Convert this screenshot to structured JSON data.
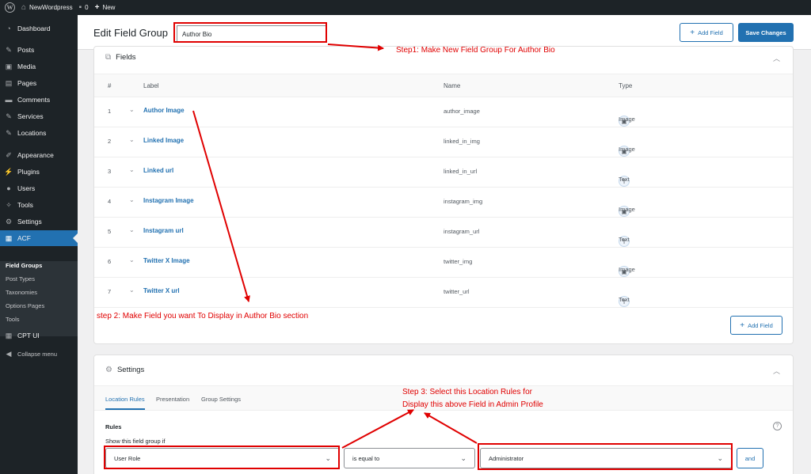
{
  "adminbar": {
    "site_name": "NewWordpress",
    "comments_count": "0",
    "new_label": "New"
  },
  "sidebar": {
    "items": [
      {
        "label": "Dashboard",
        "icon": "dashboard-icon"
      },
      {
        "label": "Posts",
        "icon": "pin-icon"
      },
      {
        "label": "Media",
        "icon": "media-icon"
      },
      {
        "label": "Pages",
        "icon": "pages-icon"
      },
      {
        "label": "Comments",
        "icon": "comment-icon"
      },
      {
        "label": "Services",
        "icon": "pin-icon"
      },
      {
        "label": "Locations",
        "icon": "pin-icon"
      },
      {
        "label": "Appearance",
        "icon": "brush-icon"
      },
      {
        "label": "Plugins",
        "icon": "plug-icon"
      },
      {
        "label": "Users",
        "icon": "users-icon"
      },
      {
        "label": "Tools",
        "icon": "wrench-icon"
      },
      {
        "label": "Settings",
        "icon": "settings-icon"
      },
      {
        "label": "ACF",
        "icon": "acf-icon"
      },
      {
        "label": "CPT UI",
        "icon": "cpt-icon"
      },
      {
        "label": "Collapse menu",
        "icon": "collapse-icon"
      }
    ],
    "submenu": [
      "Field Groups",
      "Post Types",
      "Taxonomies",
      "Options Pages",
      "Tools"
    ]
  },
  "header": {
    "title": "Edit Field Group",
    "group_title_value": "Author Bio",
    "add_field_label": "Add Field",
    "save_label": "Save Changes"
  },
  "fields_panel": {
    "title": "Fields",
    "columns": [
      "#",
      "Label",
      "Name",
      "Type"
    ],
    "rows": [
      {
        "num": "1",
        "label": "Author Image",
        "name": "author_image",
        "type": "Image"
      },
      {
        "num": "2",
        "label": "Linked Image",
        "name": "linked_in_img",
        "type": "Image"
      },
      {
        "num": "3",
        "label": "Linked url",
        "name": "linked_in_url",
        "type": "Text"
      },
      {
        "num": "4",
        "label": "Instagram Image",
        "name": "instagram_img",
        "type": "Image"
      },
      {
        "num": "5",
        "label": "Instagram url",
        "name": "instagram_url",
        "type": "Text"
      },
      {
        "num": "6",
        "label": "Twitter X Image",
        "name": "twitter_img",
        "type": "Image"
      },
      {
        "num": "7",
        "label": "Twitter X url",
        "name": "twitter_url",
        "type": "Text"
      }
    ],
    "add_field_label": "Add Field"
  },
  "settings_panel": {
    "title": "Settings",
    "tabs": [
      "Location Rules",
      "Presentation",
      "Group Settings"
    ],
    "rules_heading": "Rules",
    "rules_sub": "Show this field group if",
    "param_value": "User Role",
    "operator_value": "is equal to",
    "value_value": "Administrator",
    "and_label": "and"
  },
  "annotations": {
    "step1": "Step1: Make New Field Group For Author Bio",
    "step2": "step 2: Make Field you want To Display in Author Bio section",
    "step3_line1": "Step 3: Select this Location Rules for",
    "step3_line2": "Display this above Field in Admin Profile",
    "color": "#e00000"
  }
}
